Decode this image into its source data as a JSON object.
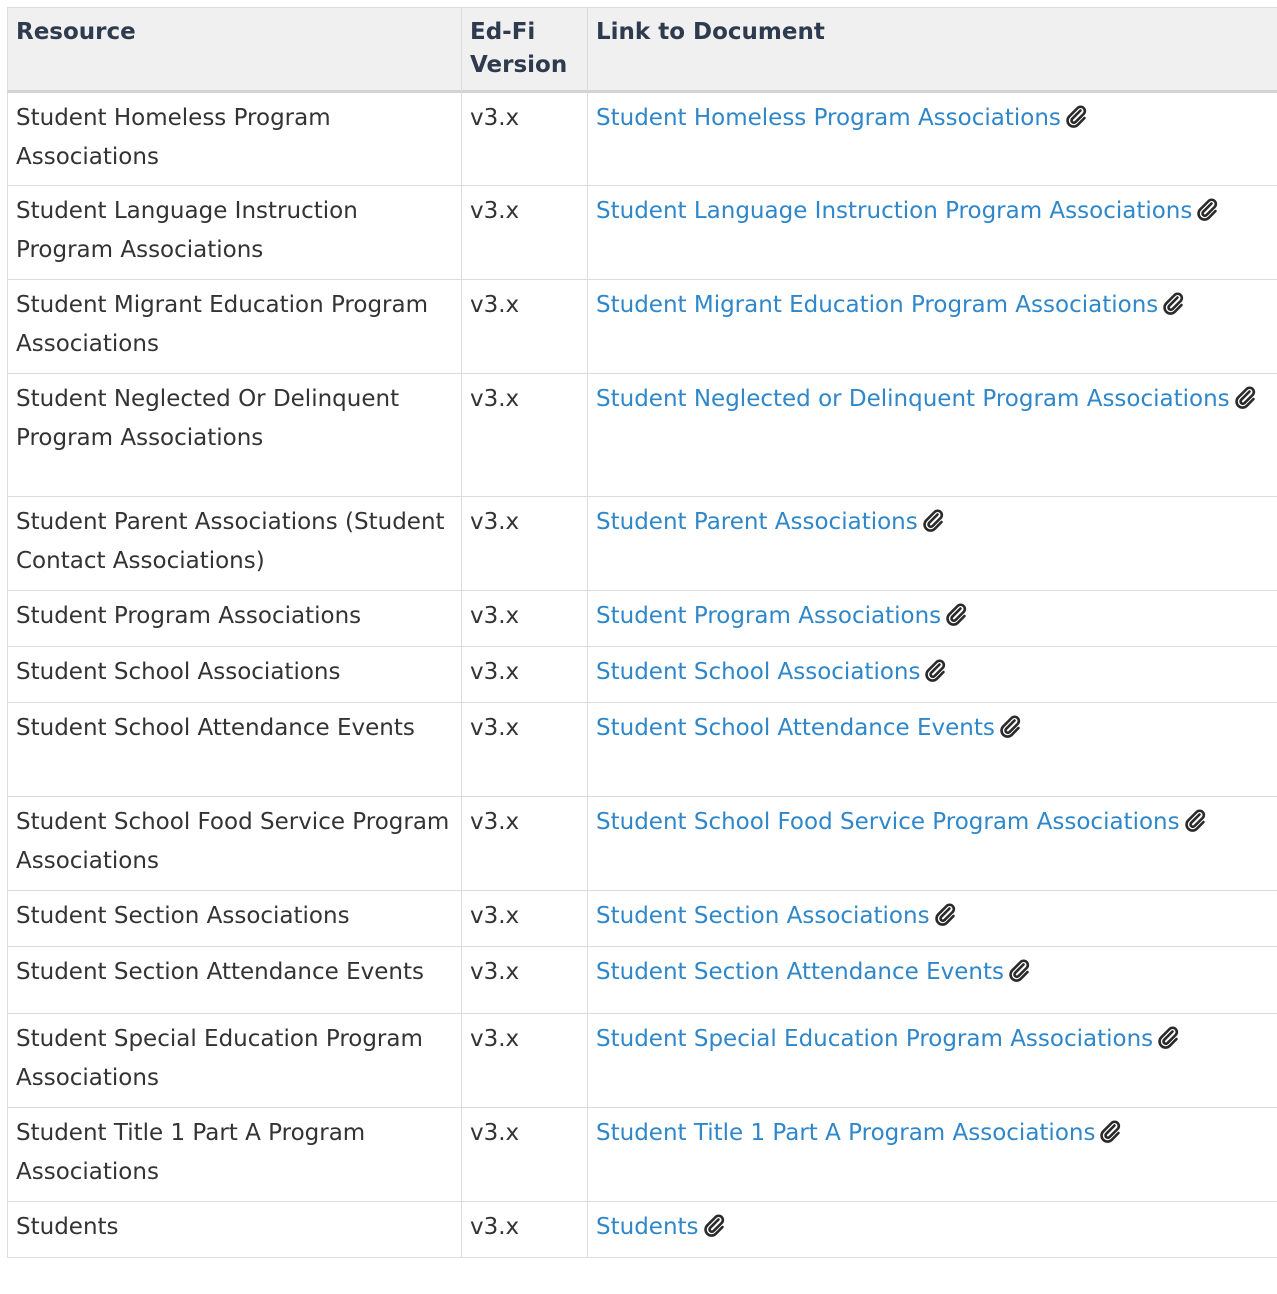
{
  "table": {
    "headers": {
      "resource": "Resource",
      "version": "Ed-Fi Version",
      "link": "Link to Document"
    },
    "rows": [
      {
        "resource": "Student Homeless Program Associations",
        "version": "v3.x",
        "link": "Student Homeless Program Associations"
      },
      {
        "resource": "Student Language Instruction Program Associations",
        "version": "v3.x",
        "link": "Student Language Instruction Program Associations"
      },
      {
        "resource": "Student Migrant Education Program Associations",
        "version": "v3.x",
        "link": "Student Migrant Education Program Associations"
      },
      {
        "resource": "Student Neglected Or Delinquent Program Associations",
        "version": "v3.x",
        "link": "Student Neglected or Delinquent Program Associations"
      },
      {
        "resource": "Student Parent Associations (Student Contact Associations)",
        "version": "v3.x",
        "link": "Student Parent Associations"
      },
      {
        "resource": "Student Program Associations",
        "version": "v3.x",
        "link": "Student Program Associations"
      },
      {
        "resource": "Student School Associations",
        "version": "v3.x",
        "link": "Student School Associations"
      },
      {
        "resource": "Student School Attendance Events",
        "version": "v3.x",
        "link": "Student School Attendance Events"
      },
      {
        "resource": "Student School Food Service Program Associations",
        "version": "v3.x",
        "link": "Student School Food Service Program Associations"
      },
      {
        "resource": "Student Section Associations",
        "version": "v3.x",
        "link": "Student Section Associations"
      },
      {
        "resource": "Student Section Attendance Events",
        "version": "v3.x",
        "link": "Student Section Attendance Events"
      },
      {
        "resource": "Student Special Education Program Associations",
        "version": "v3.x",
        "link": "Student Special Education Program Associations"
      },
      {
        "resource": "Student Title 1 Part A Program Associations",
        "version": "v3.x",
        "link": "Student Title 1 Part A Program Associations"
      },
      {
        "resource": "Students",
        "version": "v3.x",
        "link": "Students"
      }
    ]
  },
  "icons": {
    "attachment": "paperclip-icon"
  },
  "colors": {
    "link": "#2f87c9",
    "header_bg": "#f0f0f0",
    "header_text": "#2e3b4e",
    "border": "#dcdcdc"
  }
}
